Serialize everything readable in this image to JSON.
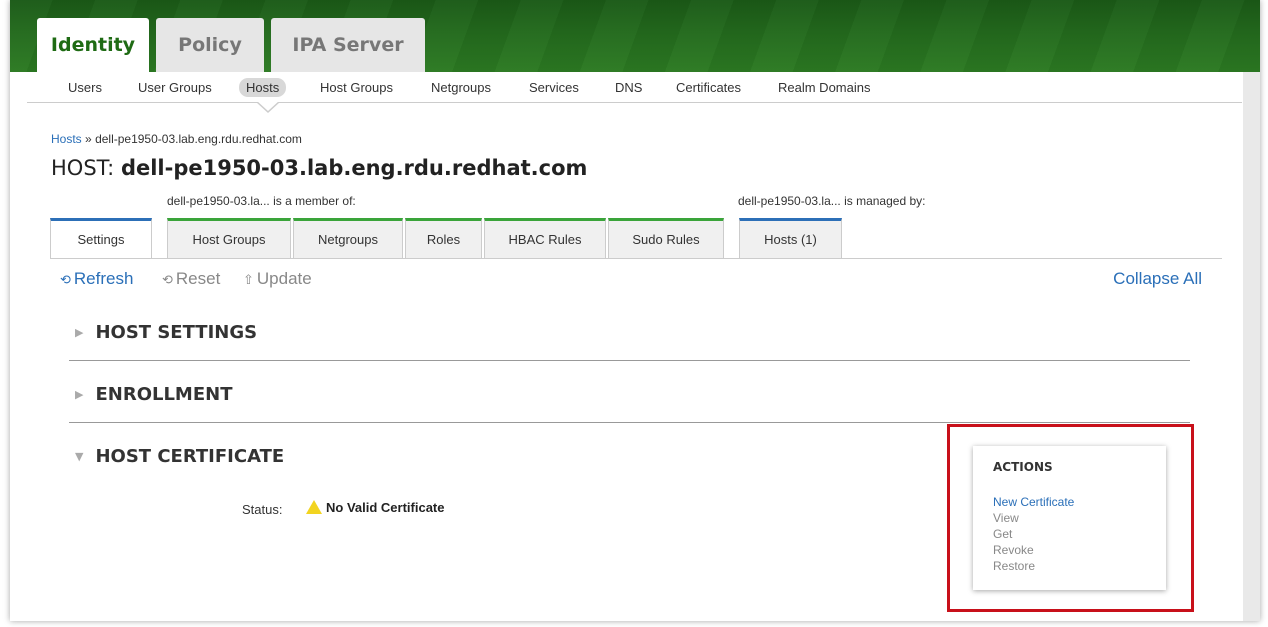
{
  "main_tabs": [
    {
      "label": "Identity"
    },
    {
      "label": "Policy"
    },
    {
      "label": "IPA Server"
    }
  ],
  "sub_nav": [
    "Users",
    "User Groups",
    "Hosts",
    "Host Groups",
    "Netgroups",
    "Services",
    "DNS",
    "Certificates",
    "Realm Domains"
  ],
  "breadcrumb": {
    "root": "Hosts",
    "separator": "»",
    "current": "dell-pe1950-03.lab.eng.rdu.redhat.com"
  },
  "title": {
    "prefix": "HOST:",
    "name": "dell-pe1950-03.lab.eng.rdu.redhat.com"
  },
  "facet_groups": {
    "member_of": "dell-pe1950-03.la... is a member of:",
    "managed_by": "dell-pe1950-03.la... is managed by:"
  },
  "facet_tabs": [
    "Settings",
    "Host Groups",
    "Netgroups",
    "Roles",
    "HBAC Rules",
    "Sudo Rules",
    "Hosts (1)"
  ],
  "toolbar": {
    "refresh": "Refresh",
    "reset": "Reset",
    "update": "Update",
    "collapse_all": "Collapse All"
  },
  "sections": {
    "host_settings": "HOST SETTINGS",
    "enrollment": "ENROLLMENT",
    "host_certificate": "HOST CERTIFICATE"
  },
  "certificate": {
    "status_label": "Status:",
    "status_value": "No Valid Certificate"
  },
  "actions": {
    "title": "ACTIONS",
    "items": [
      "New Certificate",
      "View",
      "Get",
      "Revoke",
      "Restore"
    ]
  },
  "colors": {
    "brand_green": "#1f6b14",
    "link_blue": "#2a6fb8",
    "highlight_red": "#c8101a",
    "warning_yellow": "#f2d420"
  }
}
